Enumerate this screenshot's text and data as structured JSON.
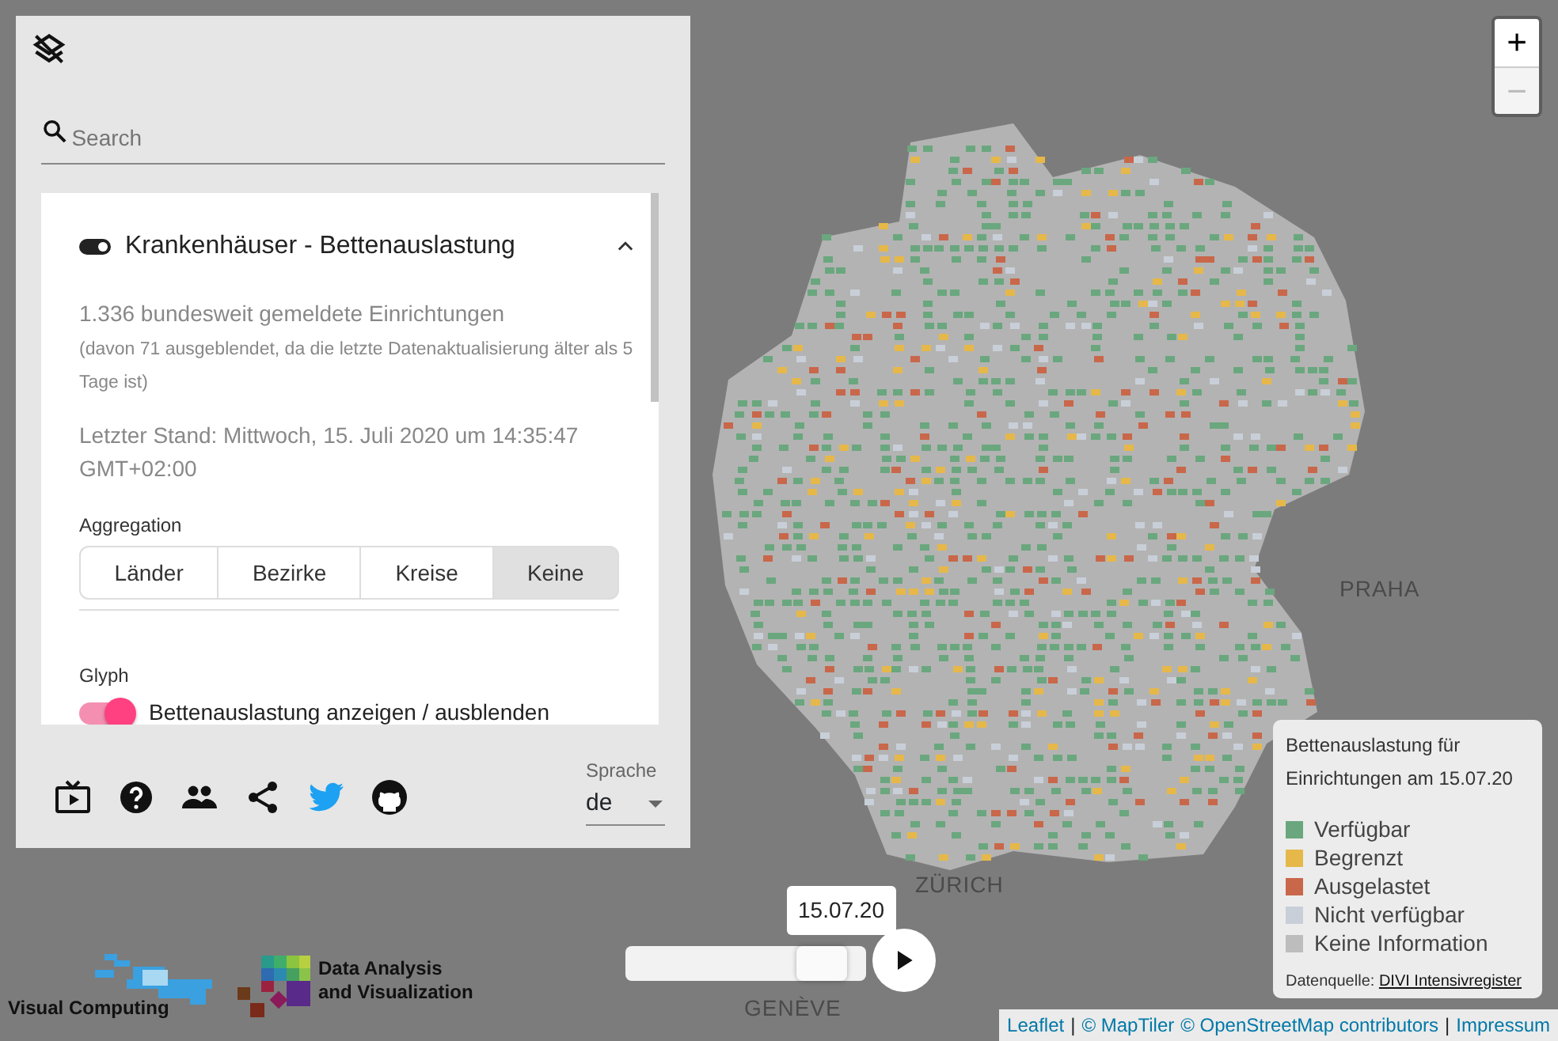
{
  "map": {
    "labels": [
      {
        "text": "PRAHA"
      },
      {
        "text": "ZÜRICH"
      },
      {
        "text": "GENÈVE"
      }
    ]
  },
  "zoom_controls": [
    {
      "label": "+",
      "disabled": false
    },
    {
      "label": "−",
      "disabled": true
    }
  ],
  "panel": {
    "search": {
      "placeholder": "Search"
    },
    "layer": {
      "title": "Krankenhäuser - Bettenauslastung",
      "on": true,
      "expanded": true,
      "summary": "1.336 bundesweit gemeldete Einrichtungen",
      "note": "(davon 71 ausgeblendet, da die letzte Datenaktualisierung älter als 5 Tage ist)",
      "updated": "Letzter Stand: Mittwoch, 15. Juli 2020 um 14:35:47 GMT+02:00",
      "aggregation_label": "Aggregation",
      "aggregation": [
        {
          "label": "Länder",
          "selected": false
        },
        {
          "label": "Bezirke",
          "selected": false
        },
        {
          "label": "Kreise",
          "selected": false
        },
        {
          "label": "Keine",
          "selected": true
        }
      ],
      "glyph_label": "Glyph",
      "glyph_toggle": {
        "label": "Bettenauslastung anzeigen / ausblenden",
        "on": true
      }
    },
    "language": {
      "label": "Sprache",
      "value": "de"
    }
  },
  "legend": {
    "title": "Bettenauslastung für Einrichtungen am 15.07.20",
    "items": [
      {
        "label": "Verfügbar",
        "color": "#6aa77e"
      },
      {
        "label": "Begrenzt",
        "color": "#e6b84a"
      },
      {
        "label": "Ausgelastet",
        "color": "#c9674a"
      },
      {
        "label": "Nicht verfügbar",
        "color": "#c9cfd8"
      },
      {
        "label": "Keine Information",
        "color": "#bdbdbd"
      }
    ],
    "source_label": "Datenquelle:",
    "source_link": "DIVI Intensivregister"
  },
  "timeline": {
    "date": "15.07.20",
    "level": 0.9
  },
  "logos": [
    {
      "text": "Visual Computing"
    },
    {
      "text": "Data Analysis and Visualization"
    }
  ],
  "attribution": [
    {
      "text": "Leaflet",
      "kind": "link"
    },
    {
      "text": "|",
      "kind": "sep"
    },
    {
      "text": "© MapTiler",
      "kind": "link"
    },
    {
      "text": "© OpenStreetMap contributors",
      "kind": "link"
    },
    {
      "text": "|",
      "kind": "sep"
    },
    {
      "text": "Impressum",
      "kind": "link"
    }
  ]
}
